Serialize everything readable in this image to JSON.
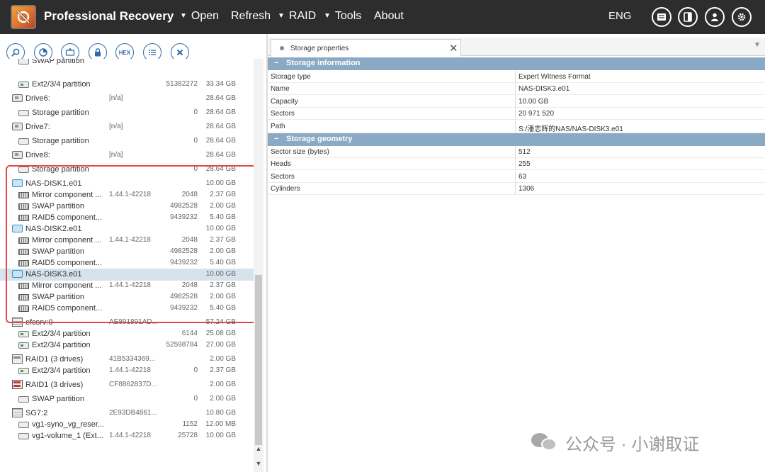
{
  "app": {
    "title": "Professional Recovery"
  },
  "menu": {
    "open": "Open",
    "refresh": "Refresh",
    "raid": "RAID",
    "tools": "Tools",
    "about": "About",
    "lang": "ENG"
  },
  "toolbar": {
    "hex_label": "HEX"
  },
  "tree": [
    {
      "name": "SWAP partition",
      "c2": "",
      "c3": "",
      "c4": "",
      "icon": "part",
      "indent": 1,
      "partial": true
    },
    {
      "name": "Ext2/3/4 partition",
      "c2": "",
      "c3": "51382272",
      "c4": "33.34 GB",
      "icon": "ext",
      "indent": 1
    },
    {
      "name": "Drive6:",
      "c2": "[n/a]",
      "c3": "",
      "c4": "28.64 GB",
      "icon": "drive",
      "indent": 0
    },
    {
      "name": "Storage partition",
      "c2": "",
      "c3": "0",
      "c4": "28.64 GB",
      "icon": "part",
      "indent": 1
    },
    {
      "name": "Drive7:",
      "c2": "[n/a]",
      "c3": "",
      "c4": "28.64 GB",
      "icon": "drive",
      "indent": 0
    },
    {
      "name": "Storage partition",
      "c2": "",
      "c3": "0",
      "c4": "28.64 GB",
      "icon": "part",
      "indent": 1
    },
    {
      "name": "Drive8:",
      "c2": "[n/a]",
      "c3": "",
      "c4": "28.64 GB",
      "icon": "drive",
      "indent": 0
    },
    {
      "name": "Storage partition",
      "c2": "",
      "c3": "0",
      "c4": "28.64 GB",
      "icon": "part",
      "indent": 1
    },
    {
      "name": "NAS-DISK1.e01",
      "c2": "",
      "c3": "",
      "c4": "10.00 GB",
      "icon": "disk",
      "indent": 0
    },
    {
      "name": "Mirror component ...",
      "c2": "1.44.1-42218",
      "c3": "2048",
      "c4": "2.37 GB",
      "icon": "comp",
      "indent": 1
    },
    {
      "name": "SWAP partition",
      "c2": "",
      "c3": "4982528",
      "c4": "2.00 GB",
      "icon": "comp",
      "indent": 1
    },
    {
      "name": "RAID5 component...",
      "c2": "",
      "c3": "9439232",
      "c4": "5.40 GB",
      "icon": "comp",
      "indent": 1
    },
    {
      "name": "NAS-DISK2.e01",
      "c2": "",
      "c3": "",
      "c4": "10.00 GB",
      "icon": "disk",
      "indent": 0
    },
    {
      "name": "Mirror component ...",
      "c2": "1.44.1-42218",
      "c3": "2048",
      "c4": "2.37 GB",
      "icon": "comp",
      "indent": 1
    },
    {
      "name": "SWAP partition",
      "c2": "",
      "c3": "4982528",
      "c4": "2.00 GB",
      "icon": "comp",
      "indent": 1
    },
    {
      "name": "RAID5 component...",
      "c2": "",
      "c3": "9439232",
      "c4": "5.40 GB",
      "icon": "comp",
      "indent": 1
    },
    {
      "name": "NAS-DISK3.e01",
      "c2": "",
      "c3": "",
      "c4": "10.00 GB",
      "icon": "disk",
      "indent": 0,
      "selected": true
    },
    {
      "name": "Mirror component ...",
      "c2": "1.44.1-42218",
      "c3": "2048",
      "c4": "2.37 GB",
      "icon": "comp",
      "indent": 1
    },
    {
      "name": "SWAP partition",
      "c2": "",
      "c3": "4982528",
      "c4": "2.00 GB",
      "icon": "comp",
      "indent": 1
    },
    {
      "name": "RAID5 component...",
      "c2": "",
      "c3": "9439232",
      "c4": "5.40 GB",
      "icon": "comp",
      "indent": 1
    },
    {
      "name": "efcsrv:0",
      "c2": "AE891891AD...",
      "c3": "",
      "c4": "57.24 GB",
      "icon": "server",
      "indent": 0
    },
    {
      "name": "Ext2/3/4 partition",
      "c2": "",
      "c3": "6144",
      "c4": "25.08 GB",
      "icon": "ext",
      "indent": 1
    },
    {
      "name": "Ext2/3/4 partition",
      "c2": "",
      "c3": "52598784",
      "c4": "27.00 GB",
      "icon": "ext",
      "indent": 1
    },
    {
      "name": "RAID1 (3 drives)",
      "c2": "41B5334369...",
      "c3": "",
      "c4": "2.00 GB",
      "icon": "raid",
      "indent": 0
    },
    {
      "name": "Ext2/3/4 partition",
      "c2": "1.44.1-42218",
      "c3": "0",
      "c4": "2.37 GB",
      "icon": "ext",
      "indent": 1
    },
    {
      "name": "RAID1 (3 drives)",
      "c2": "CF8862837D...",
      "c3": "",
      "c4": "2.00 GB",
      "icon": "raid-red",
      "indent": 0
    },
    {
      "name": "SWAP partition",
      "c2": "",
      "c3": "0",
      "c4": "2.00 GB",
      "icon": "part",
      "indent": 1
    },
    {
      "name": "SG7:2",
      "c2": "2E93DB4861...",
      "c3": "",
      "c4": "10.80 GB",
      "icon": "server",
      "indent": 0
    },
    {
      "name": "vg1-syno_vg_reser...",
      "c2": "",
      "c3": "1152",
      "c4": "12.00 MB",
      "icon": "part",
      "indent": 1
    },
    {
      "name": "vg1-volume_1 (Ext...",
      "c2": "1.44.1-42218",
      "c3": "25728",
      "c4": "10.00 GB",
      "icon": "part",
      "indent": 1
    }
  ],
  "tab": {
    "label": "Storage properties"
  },
  "sections": {
    "info": "Storage information",
    "geometry": "Storage geometry"
  },
  "info_props": [
    {
      "key": "Storage type",
      "value": "Expert Witness Format"
    },
    {
      "key": "Name",
      "value": "NAS-DISK3.e01"
    },
    {
      "key": "Capacity",
      "value": "10.00 GB"
    },
    {
      "key": "Sectors",
      "value": "20 971 520"
    },
    {
      "key": "Path",
      "value": "S:/潘志辉的NAS/NAS-DISK3.e01"
    }
  ],
  "geometry_props": [
    {
      "key": "Sector size (bytes)",
      "value": "512"
    },
    {
      "key": "Heads",
      "value": "255"
    },
    {
      "key": "Sectors",
      "value": "63"
    },
    {
      "key": "Cylinders",
      "value": "1306"
    }
  ],
  "watermark": {
    "text": "公众号 · 小谢取证"
  }
}
